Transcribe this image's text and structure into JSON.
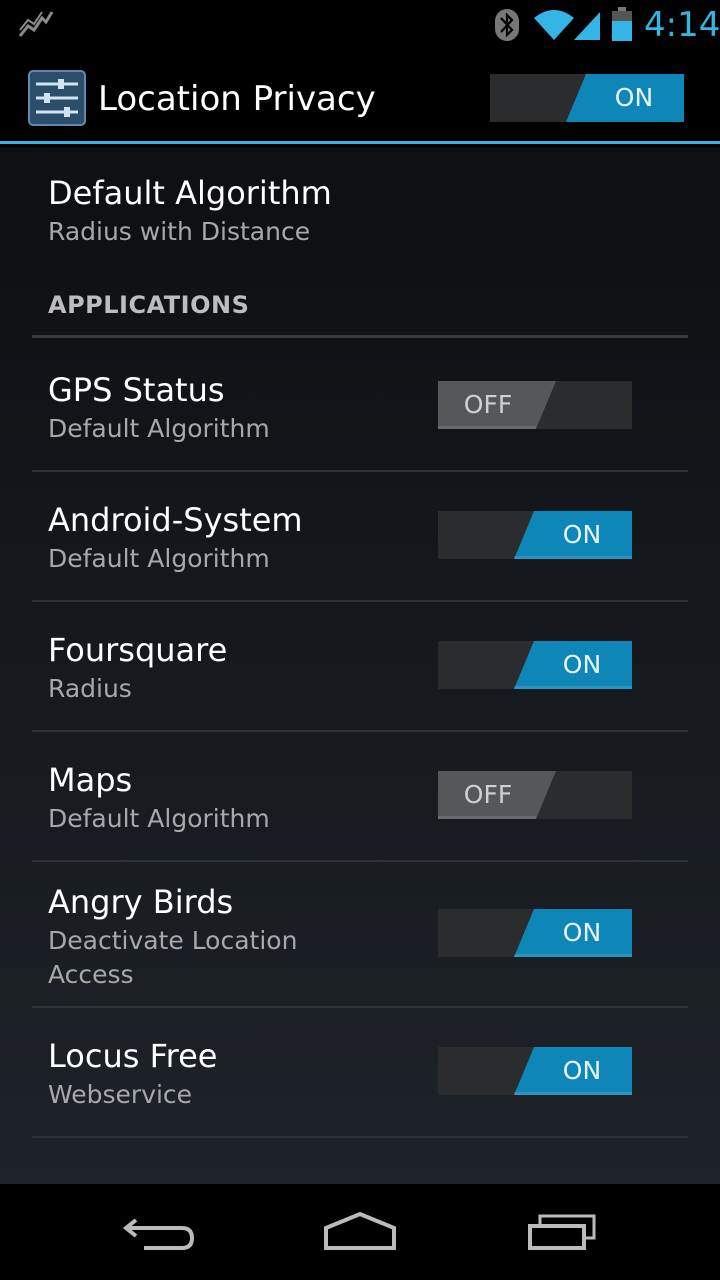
{
  "status_bar": {
    "time": "4:14",
    "icons": [
      "activity-stats-icon",
      "bluetooth-icon",
      "wifi-icon",
      "cell-signal-icon",
      "battery-icon"
    ],
    "accent_color": "#33b5e5"
  },
  "action_bar": {
    "title": "Location Privacy",
    "app_icon": "settings-sliders-icon",
    "master_switch": {
      "label": "ON",
      "state": "on"
    }
  },
  "default_algorithm": {
    "title": "Default Algorithm",
    "summary": "Radius with Distance"
  },
  "category": {
    "label": "APPLICATIONS"
  },
  "applications": [
    {
      "name": "GPS Status",
      "summary": "Default Algorithm",
      "toggle": {
        "label": "OFF",
        "state": "off"
      }
    },
    {
      "name": "Android-System",
      "summary": "Default Algorithm",
      "toggle": {
        "label": "ON",
        "state": "on"
      }
    },
    {
      "name": "Foursquare",
      "summary": "Radius",
      "toggle": {
        "label": "ON",
        "state": "on"
      }
    },
    {
      "name": "Maps",
      "summary": "Default Algorithm",
      "toggle": {
        "label": "OFF",
        "state": "off"
      }
    },
    {
      "name": "Angry Birds",
      "summary_line1": "Deactivate Location",
      "summary_line2": "Access",
      "toggle": {
        "label": "ON",
        "state": "on"
      }
    },
    {
      "name": "Locus Free",
      "summary": "Webservice",
      "toggle": {
        "label": "ON",
        "state": "on"
      }
    }
  ],
  "nav_bar": {
    "icons": [
      "back-icon",
      "home-icon",
      "recent-apps-icon"
    ]
  },
  "colors": {
    "accent": "#33b5e5",
    "toggle_on": "#0e87b8",
    "toggle_off": "#555759"
  }
}
